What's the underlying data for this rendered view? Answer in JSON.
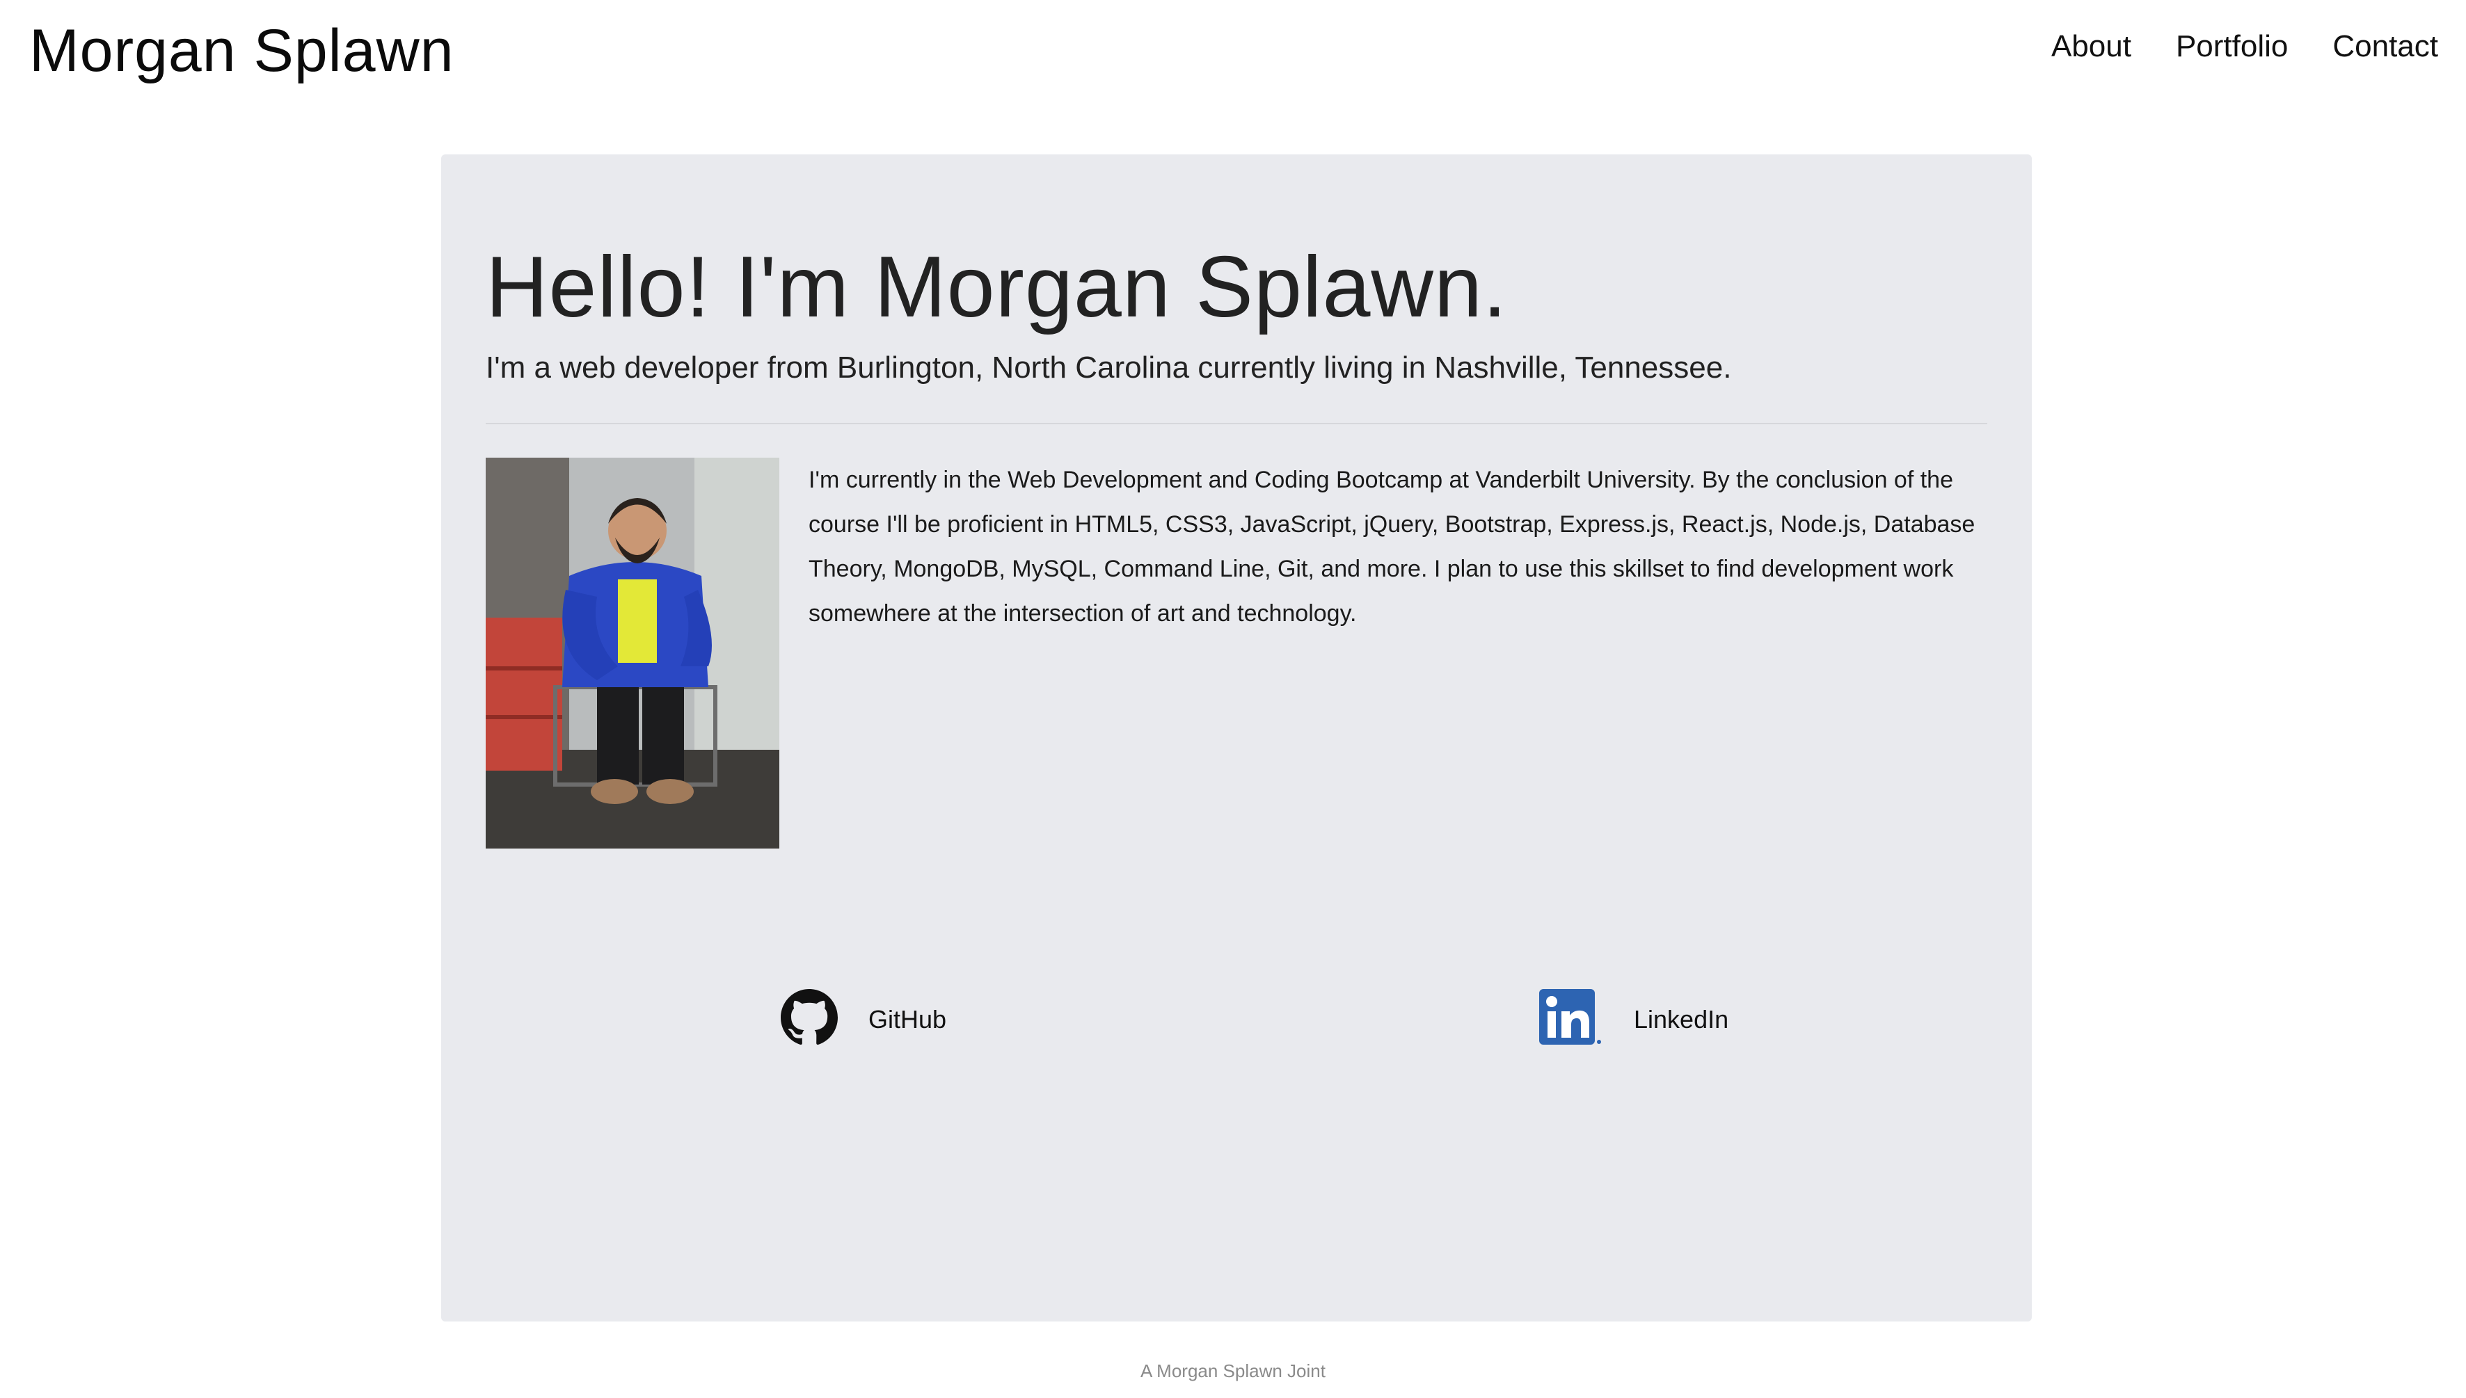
{
  "header": {
    "brand": "Morgan Splawn",
    "nav": [
      {
        "label": "About"
      },
      {
        "label": "Portfolio"
      },
      {
        "label": "Contact"
      }
    ]
  },
  "main": {
    "heading": "Hello!  I'm Morgan Splawn.",
    "subheading": "I'm a web developer from Burlington, North Carolina currently living in Nashville, Tennessee.",
    "bio": "I'm currently in the Web Development and Coding Bootcamp at Vanderbilt University. By the conclusion of the course I'll be proficient in HTML5, CSS3, JavaScript, jQuery, Bootstrap, Express.js, React.js, Node.js, Database Theory, MongoDB, MySQL, Command Line, Git, and more. I plan to use this skillset to find development work somewhere at the intersection of art and technology.",
    "social": [
      {
        "label": "GitHub",
        "icon": "github-icon"
      },
      {
        "label": "LinkedIn",
        "icon": "linkedin-icon"
      }
    ]
  },
  "footer": {
    "text": "A Morgan Splawn Joint"
  },
  "colors": {
    "card_background": "#e9eaee",
    "linkedin_blue": "#2d64b2",
    "text": "#222222"
  }
}
